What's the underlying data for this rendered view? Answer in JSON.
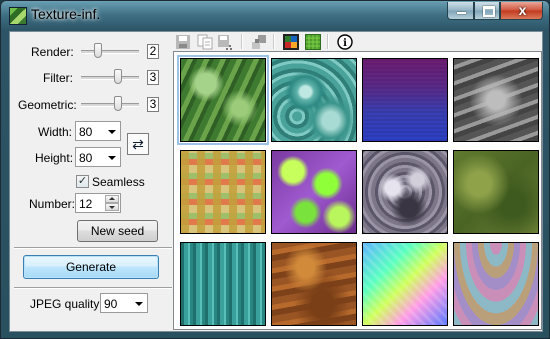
{
  "window": {
    "title": "Texture-inf.",
    "close_glyph": "x"
  },
  "toolbar": {
    "tools": [
      "save-icon",
      "copy-icon",
      "save-as-icon",
      "tile-icon",
      "palette-icon",
      "texture-icon",
      "info-icon"
    ],
    "info_glyph": "i"
  },
  "settings": {
    "render_label": "Render:",
    "render_value": "2",
    "filter_label": "Filter:",
    "filter_value": "3",
    "geometric_label": "Geometric:",
    "geometric_value": "3",
    "width_label": "Width:",
    "width_value": "80",
    "height_label": "Height:",
    "height_value": "80",
    "seamless_label": "Seamless",
    "seamless_checked": true,
    "number_label": "Number:",
    "number_value": "12",
    "new_seed_label": "New seed",
    "generate_label": "Generate",
    "jpeg_label": "JPEG quality:",
    "jpeg_value": "90"
  },
  "textures": [
    {
      "name": "green-foliage"
    },
    {
      "name": "teal-marble"
    },
    {
      "name": "purple-blue-gradient"
    },
    {
      "name": "gray-waves"
    },
    {
      "name": "brick-weave"
    },
    {
      "name": "purple-green-blobs"
    },
    {
      "name": "gray-rock"
    },
    {
      "name": "olive-moss"
    },
    {
      "name": "teal-stripes"
    },
    {
      "name": "rust-brown"
    },
    {
      "name": "rainbow-plasma"
    },
    {
      "name": "pastel-swirl"
    }
  ]
}
